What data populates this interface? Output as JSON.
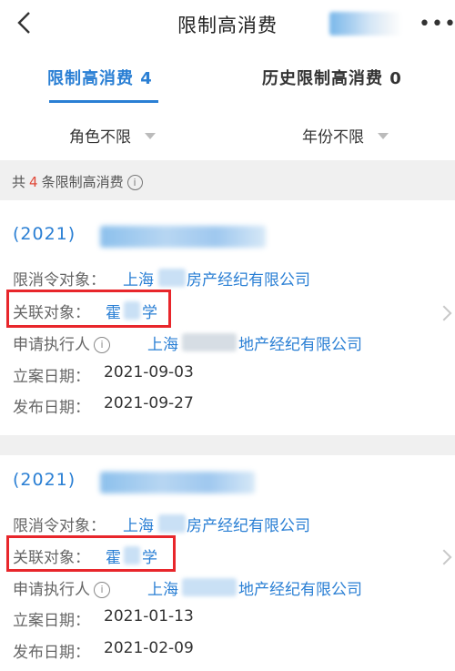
{
  "header": {
    "title": "限制高消费",
    "more": "•••"
  },
  "tabs": [
    {
      "label": "限制高消费 4"
    },
    {
      "label": "历史限制高消费 0"
    }
  ],
  "filters": [
    {
      "label": "角色不限"
    },
    {
      "label": "年份不限"
    }
  ],
  "summary": {
    "prefix": "共",
    "count": "4",
    "suffix": "条限制高消费"
  },
  "records": [
    {
      "case_no": "(2021)",
      "target_label": "限消令对象：",
      "target_value_a": "上海",
      "target_value_b": "房产经纪有限公司",
      "related_label": "关联对象：",
      "related_value_a": "霍",
      "related_value_b": "学",
      "applicant_label": "申请执行人",
      "applicant_value_a": "上海",
      "applicant_value_b": "地产经纪有限公司",
      "filed_label": "立案日期：",
      "filed_value": "2021-09-03",
      "published_label": "发布日期：",
      "published_value": "2021-09-27"
    },
    {
      "case_no": "(2021)",
      "target_label": "限消令对象：",
      "target_value_a": "上海",
      "target_value_b": "房产经纪有限公司",
      "related_label": "关联对象：",
      "related_value_a": "霍",
      "related_value_b": "学",
      "applicant_label": "申请执行人",
      "applicant_value_a": "上海",
      "applicant_value_b": "地产经纪有限公司",
      "filed_label": "立案日期：",
      "filed_value": "2021-01-13",
      "published_label": "发布日期：",
      "published_value": "2021-02-09"
    }
  ],
  "colors": {
    "accent": "#2a7fd4",
    "highlight_box": "#e8262b",
    "count_number": "#e04a3a",
    "background_gray": "#f0f0f0"
  }
}
